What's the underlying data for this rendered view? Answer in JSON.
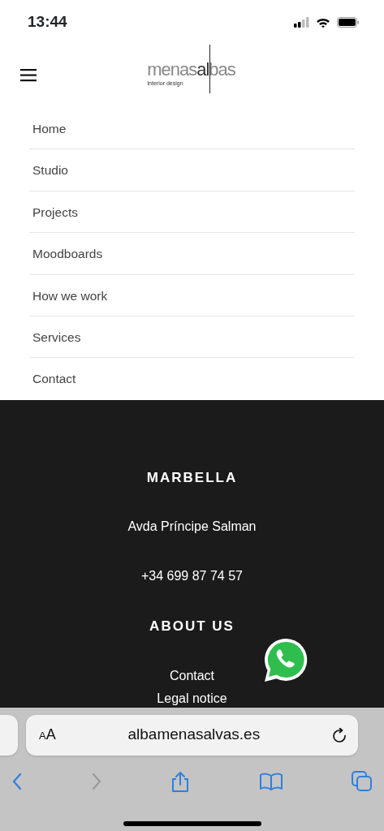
{
  "status_bar": {
    "time": "13:44"
  },
  "header": {
    "logo": {
      "wordmark": "menas**al**bas",
      "tagline": "Interior design"
    }
  },
  "menu": [
    {
      "label": "Home"
    },
    {
      "label": "Studio"
    },
    {
      "label": "Projects"
    },
    {
      "label": "Moodboards"
    },
    {
      "label": "How we work"
    },
    {
      "label": "Services"
    },
    {
      "label": "Contact"
    }
  ],
  "footer": {
    "sections": [
      {
        "kind": "heading",
        "text": "MARBELLA"
      },
      {
        "kind": "text",
        "text": "Avda Príncipe Salman"
      },
      {
        "kind": "text",
        "text": "+34 699 87 74 57"
      },
      {
        "kind": "heading",
        "text": "ABOUT US"
      },
      {
        "kind": "link",
        "text": "Contact"
      },
      {
        "kind": "link",
        "text": "Legal notice"
      }
    ]
  },
  "browser": {
    "text_size_button": "AA",
    "url": "albamenasalvas.es",
    "toolbar": [
      {
        "kind": "back",
        "disabled": false
      },
      {
        "kind": "forward",
        "disabled": true
      },
      {
        "kind": "share",
        "disabled": false
      },
      {
        "kind": "bookmarks",
        "disabled": false
      },
      {
        "kind": "tabs",
        "disabled": false
      }
    ]
  }
}
